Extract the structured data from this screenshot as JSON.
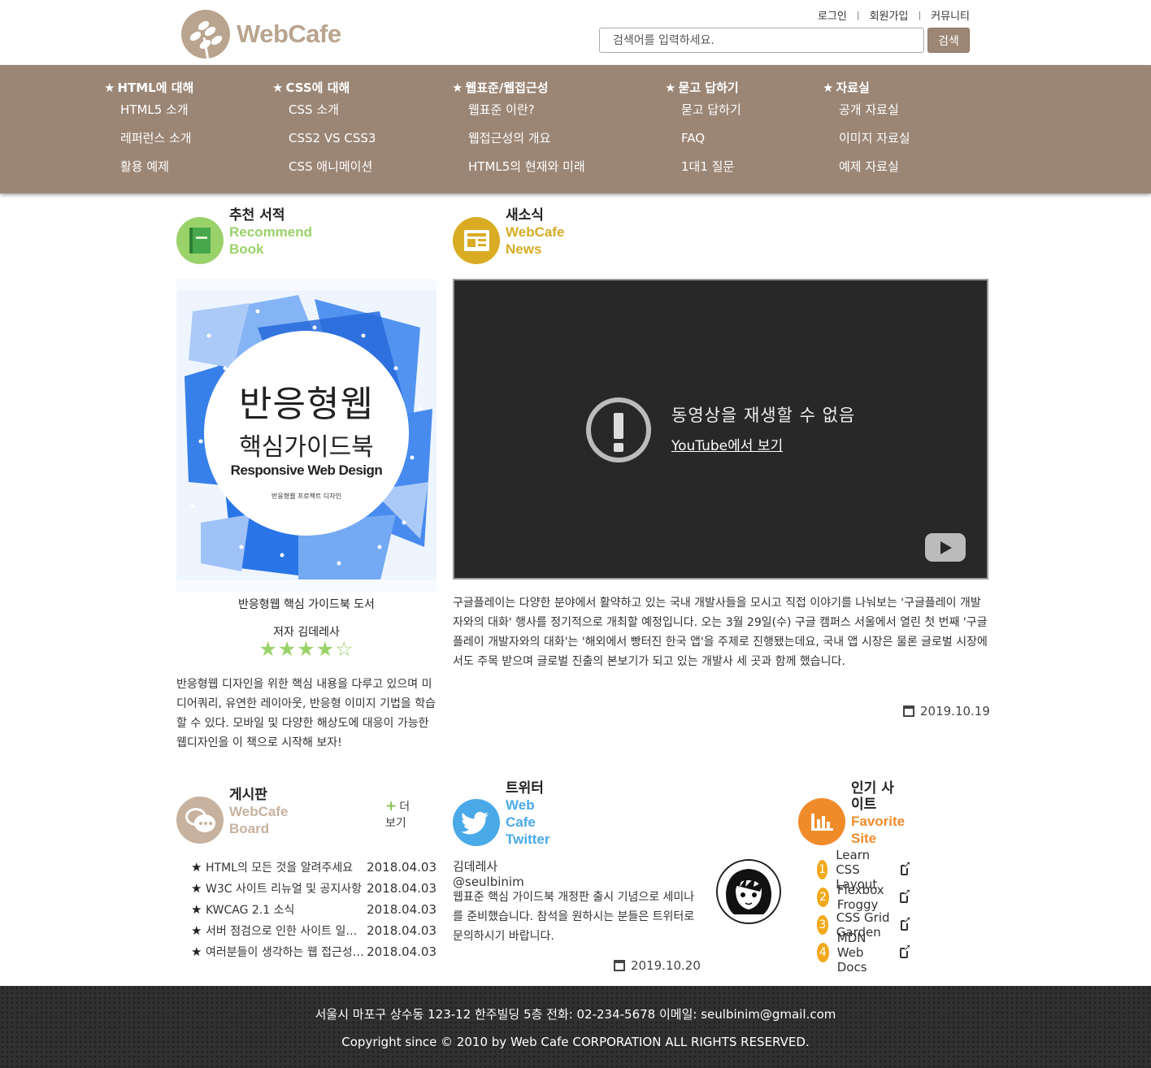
{
  "brand": {
    "name": "WebCafe"
  },
  "util_links": [
    "로그인",
    "회원가입",
    "커뮤니티"
  ],
  "search": {
    "placeholder": "검색어를 입력하세요.",
    "button": "검색"
  },
  "nav": [
    {
      "title": "HTML에 대해",
      "items": [
        "HTML5 소개",
        "레퍼런스 소개",
        "활용 예제"
      ]
    },
    {
      "title": "CSS에 대해",
      "items": [
        "CSS 소개",
        "CSS2 VS CSS3",
        "CSS 애니메이션"
      ]
    },
    {
      "title": "웹표준/웹접근성",
      "items": [
        "웹표준 이란?",
        "웹접근성의 개요",
        "HTML5의 현재와 미래"
      ]
    },
    {
      "title": "묻고 답하기",
      "items": [
        "묻고 답하기",
        "FAQ",
        "1대1 질문"
      ]
    },
    {
      "title": "자료실",
      "items": [
        "공개 자료실",
        "이미지 자료실",
        "예제 자료실"
      ]
    }
  ],
  "book": {
    "title_ko": "추천 서적",
    "title_en": "Recommend Book",
    "cover": {
      "line1": "반응형웹",
      "line2": "핵심가이드북",
      "line3": "Responsive Web Design",
      "line4": "반응형웹 프로젝트 디자인"
    },
    "caption": "반응형웹 핵심 가이드북 도서",
    "author": "저자 김데레사",
    "rating": 4,
    "rating_max": 5,
    "stars_text": "★★★★☆",
    "description": "반응형웹 디자인을 위한 핵심 내용을 다루고 있으며 미디어쿼리, 유연한 레이아웃, 반응형 이미지 기법을 학습할 수 있다. 모바일 및 다양한 해상도에 대응이 가능한 웹디자인을 이 책으로 시작해 보자!"
  },
  "news": {
    "title_ko": "새소식",
    "title_en": "WebCafe News",
    "video_message": "동영상을 재생할 수 없음",
    "video_link": "YouTube에서 보기",
    "text": "구글플레이는 다양한 분야에서 활약하고 있는 국내 개발사들을 모시고 직접 이야기를 나눠보는 '구글플레이 개발자와의 대화' 행사를 정기적으로 개최할 예정입니다. 오는 3월 29일(수) 구글 캠퍼스 서울에서 열린 첫 번째 '구글플레이 개발자와의 대화'는 '해외에서 빵터진 한국 앱'을 주제로 진행됐는데요, 국내 앱 시장은 물론 글로벌 시장에서도 주목 받으며 글로벌 진출의 본보기가 되고 있는 개발사 세 곳과 함께 했습니다.",
    "date": "2019.10.19"
  },
  "board": {
    "title_ko": "게시판",
    "title_en": "WebCafe Board",
    "more": "더보기",
    "items": [
      {
        "title": "HTML의 모든 것을 알려주세요",
        "date": "2018.04.03"
      },
      {
        "title": "W3C 사이트 리뉴얼 및 공지사항",
        "date": "2018.04.03"
      },
      {
        "title": "KWCAG 2.1 소식",
        "date": "2018.04.03"
      },
      {
        "title": "서버 점검으로 인한 사이트 일시 중단",
        "date": "2018.04.03"
      },
      {
        "title": "여러분들이 생각하는 웹 접근성이란",
        "date": "2018.04.03"
      }
    ]
  },
  "twitter": {
    "title_ko": "트위터",
    "title_en": "Web Cafe Twitter",
    "user": "김데레사 @seulbinim",
    "text": "웹표준 핵심 가이드북 개정판 출시 기념으로 세미나를 준비했습니다. 참석을 원하시는 분들은 트위터로 문의하시기 바랍니다.",
    "date": "2019.10.20"
  },
  "sites": {
    "title_ko": "인기 사이트",
    "title_en": "Favorite Site",
    "items": [
      {
        "num": "1",
        "name": "Learn CSS Layout"
      },
      {
        "num": "2",
        "name": "Flexbox Froggy"
      },
      {
        "num": "3",
        "name": "CSS Grid Garden"
      },
      {
        "num": "4",
        "name": "MDN Web Docs"
      }
    ]
  },
  "footer": {
    "address": "서울시 마포구 상수동 123-12 한주빌딩 5층 전화: 02-234-5678 이메일: seulbinim@gmail.com",
    "copyright": "Copyright since © 2010 by Web Cafe CORPORATION ALL RIGHTS RESERVED."
  },
  "colors": {
    "brand": "#b9a48f",
    "nav_bg": "#9b8676",
    "book_green": "#9ad26a",
    "news_gold": "#d9ac24",
    "board_tan": "#c7b29f",
    "twitter_blue": "#4aa9e8",
    "sites_orange": "#f08b2a",
    "footer_bg": "#303030"
  },
  "icons": [
    "coffee-bean-logo-icon",
    "star-icon",
    "book-icon",
    "newspaper-icon",
    "chat-bubbles-icon",
    "twitter-bird-icon",
    "bar-chart-icon",
    "calendar-icon",
    "external-link-icon",
    "warning-icon",
    "youtube-play-icon",
    "plus-icon"
  ]
}
